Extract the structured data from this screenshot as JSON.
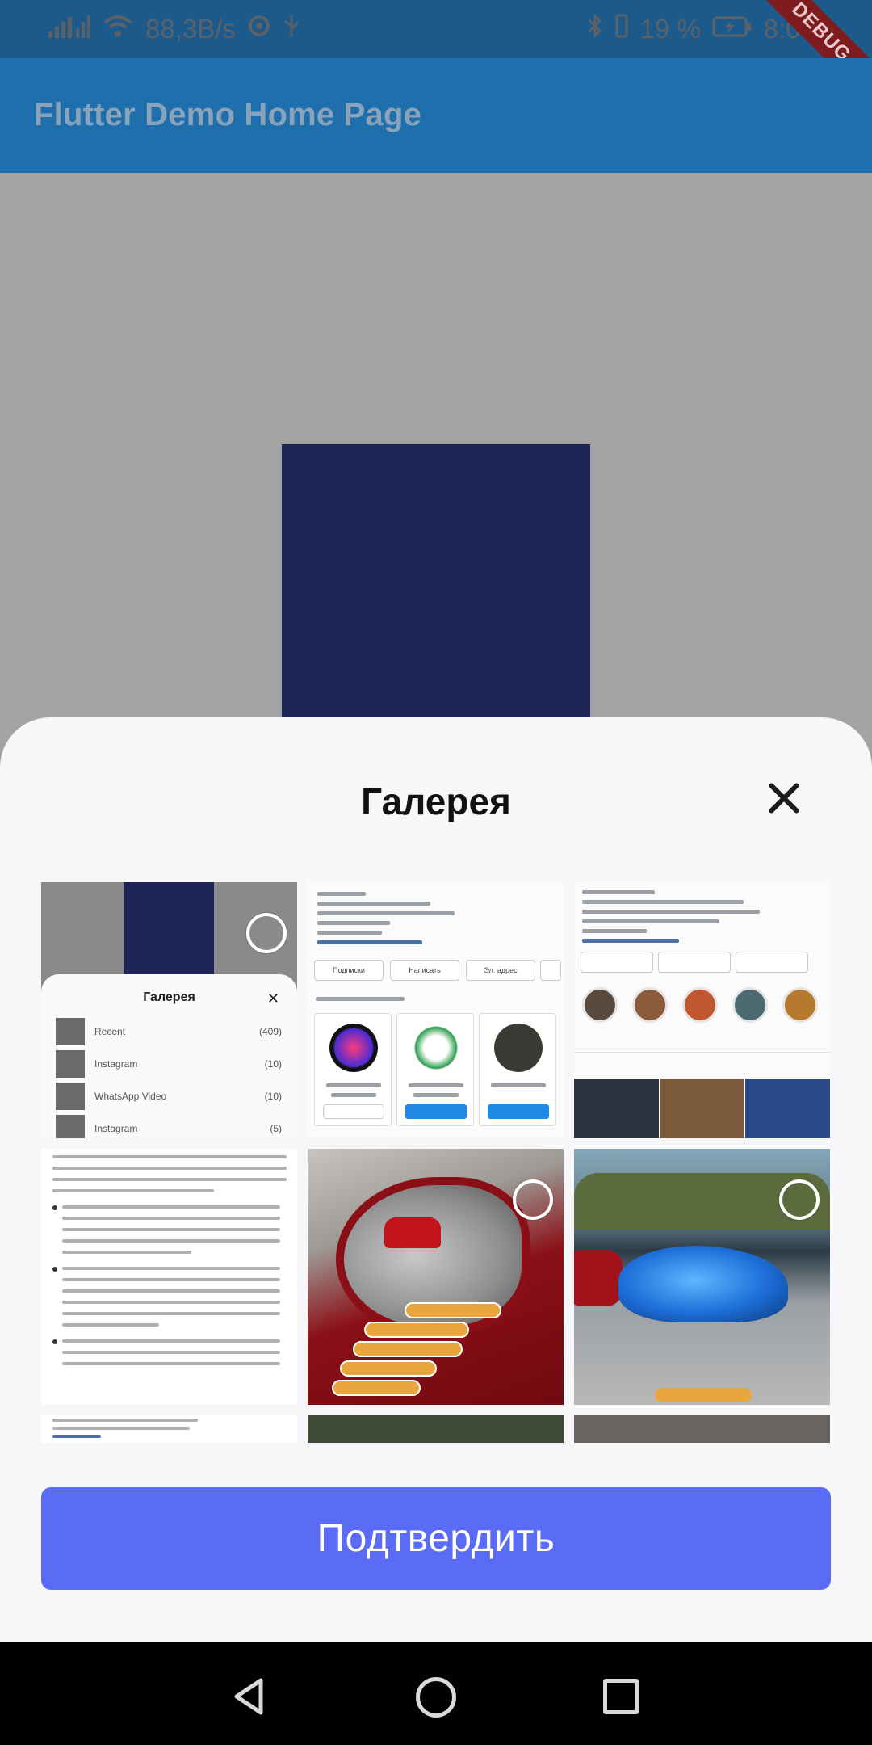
{
  "status_bar": {
    "net_speed": "88,3B/s",
    "battery": "19 %",
    "time": "8:05"
  },
  "app_bar": {
    "title": "Flutter Demo Home Page"
  },
  "debug_banner": "DEBUG",
  "sheet": {
    "title": "Галерея",
    "confirm_label": "Подтвердить"
  },
  "mini_sheet": {
    "title": "Галерея",
    "albums": [
      {
        "name": "Recent",
        "count": "(409)"
      },
      {
        "name": "Instagram",
        "count": "(10)"
      },
      {
        "name": "WhatsApp Video",
        "count": "(10)"
      },
      {
        "name": "Instagram",
        "count": "(5)"
      }
    ]
  },
  "instagram_thumb": {
    "pill_1": "Подписки",
    "pill_2": "Написать",
    "pill_3": "Эл. адрес"
  },
  "colors": {
    "accent": "#5a6cf5",
    "appbar": "#1e6fac",
    "navy_box": "#1f2456"
  }
}
